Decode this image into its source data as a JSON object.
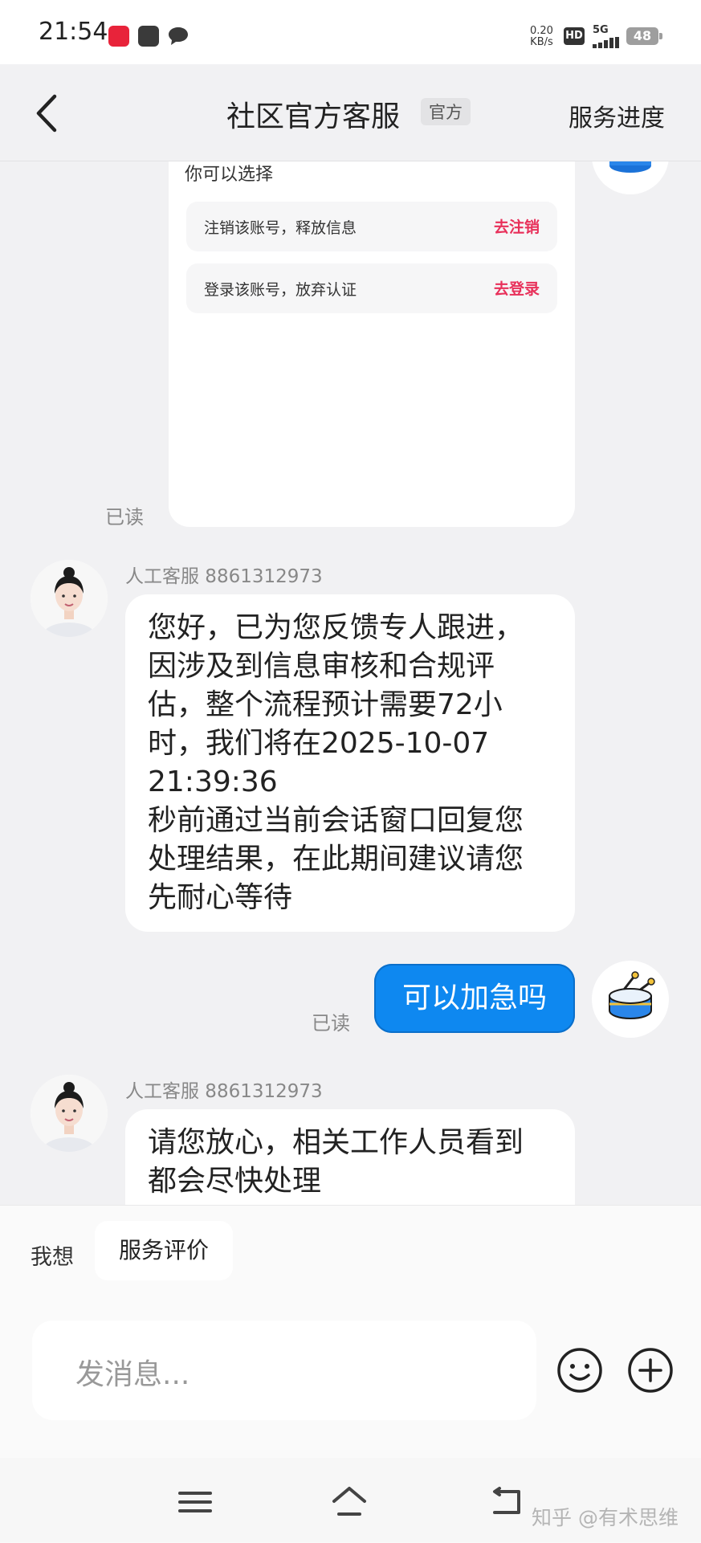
{
  "status_bar": {
    "time": "21:54",
    "net_speed_value": "0.20",
    "net_speed_unit": "KB/s",
    "hd": "HD",
    "network": "5G",
    "battery": "48",
    "app_icons": [
      "app-red-icon",
      "app-gray-icon",
      "message-bubble-icon"
    ]
  },
  "header": {
    "back_icon": "chevron-left-icon",
    "title": "社区官方客服",
    "tag": "官方",
    "right_action": "服务进度"
  },
  "messages": {
    "card": {
      "text": "你可以选择",
      "options": [
        {
          "label": "注销该账号，释放信息",
          "action": "去注销"
        },
        {
          "label": "登录该账号，放弃认证",
          "action": "去登录"
        }
      ],
      "read_status": "已读"
    },
    "agent_msg_1": {
      "name": "人工客服 8861312973",
      "lines": [
        "您好，已为您反馈专人跟进，",
        "因涉及到信息审核和合规评",
        "估，整个流程预计需要72小",
        "时，我们将在2025-10-07",
        "21:39:36",
        "秒前通过当前会话窗口回复您",
        "处理结果，在此期间建议请您",
        "先耐心等待"
      ]
    },
    "my_msg": {
      "text": "可以加急吗",
      "read_status": "已读"
    },
    "agent_msg_2": {
      "name": "人工客服 8861312973",
      "lines": [
        "请您放心，相关工作人员看到",
        "都会尽快处理"
      ]
    }
  },
  "bottom": {
    "quick_label": "我想",
    "quick_chip": "服务评价",
    "input_placeholder": "发消息...",
    "emoji_icon": "smiley-icon",
    "plus_icon": "plus-circle-icon"
  },
  "navbar": {
    "icons": [
      "menu-icon",
      "home-icon",
      "back-nav-icon"
    ],
    "watermark": "知乎 @有术思维"
  },
  "colors": {
    "accent_blue": "#0e88f0",
    "action_red": "#e8305a",
    "background": "#f1f1f3"
  }
}
